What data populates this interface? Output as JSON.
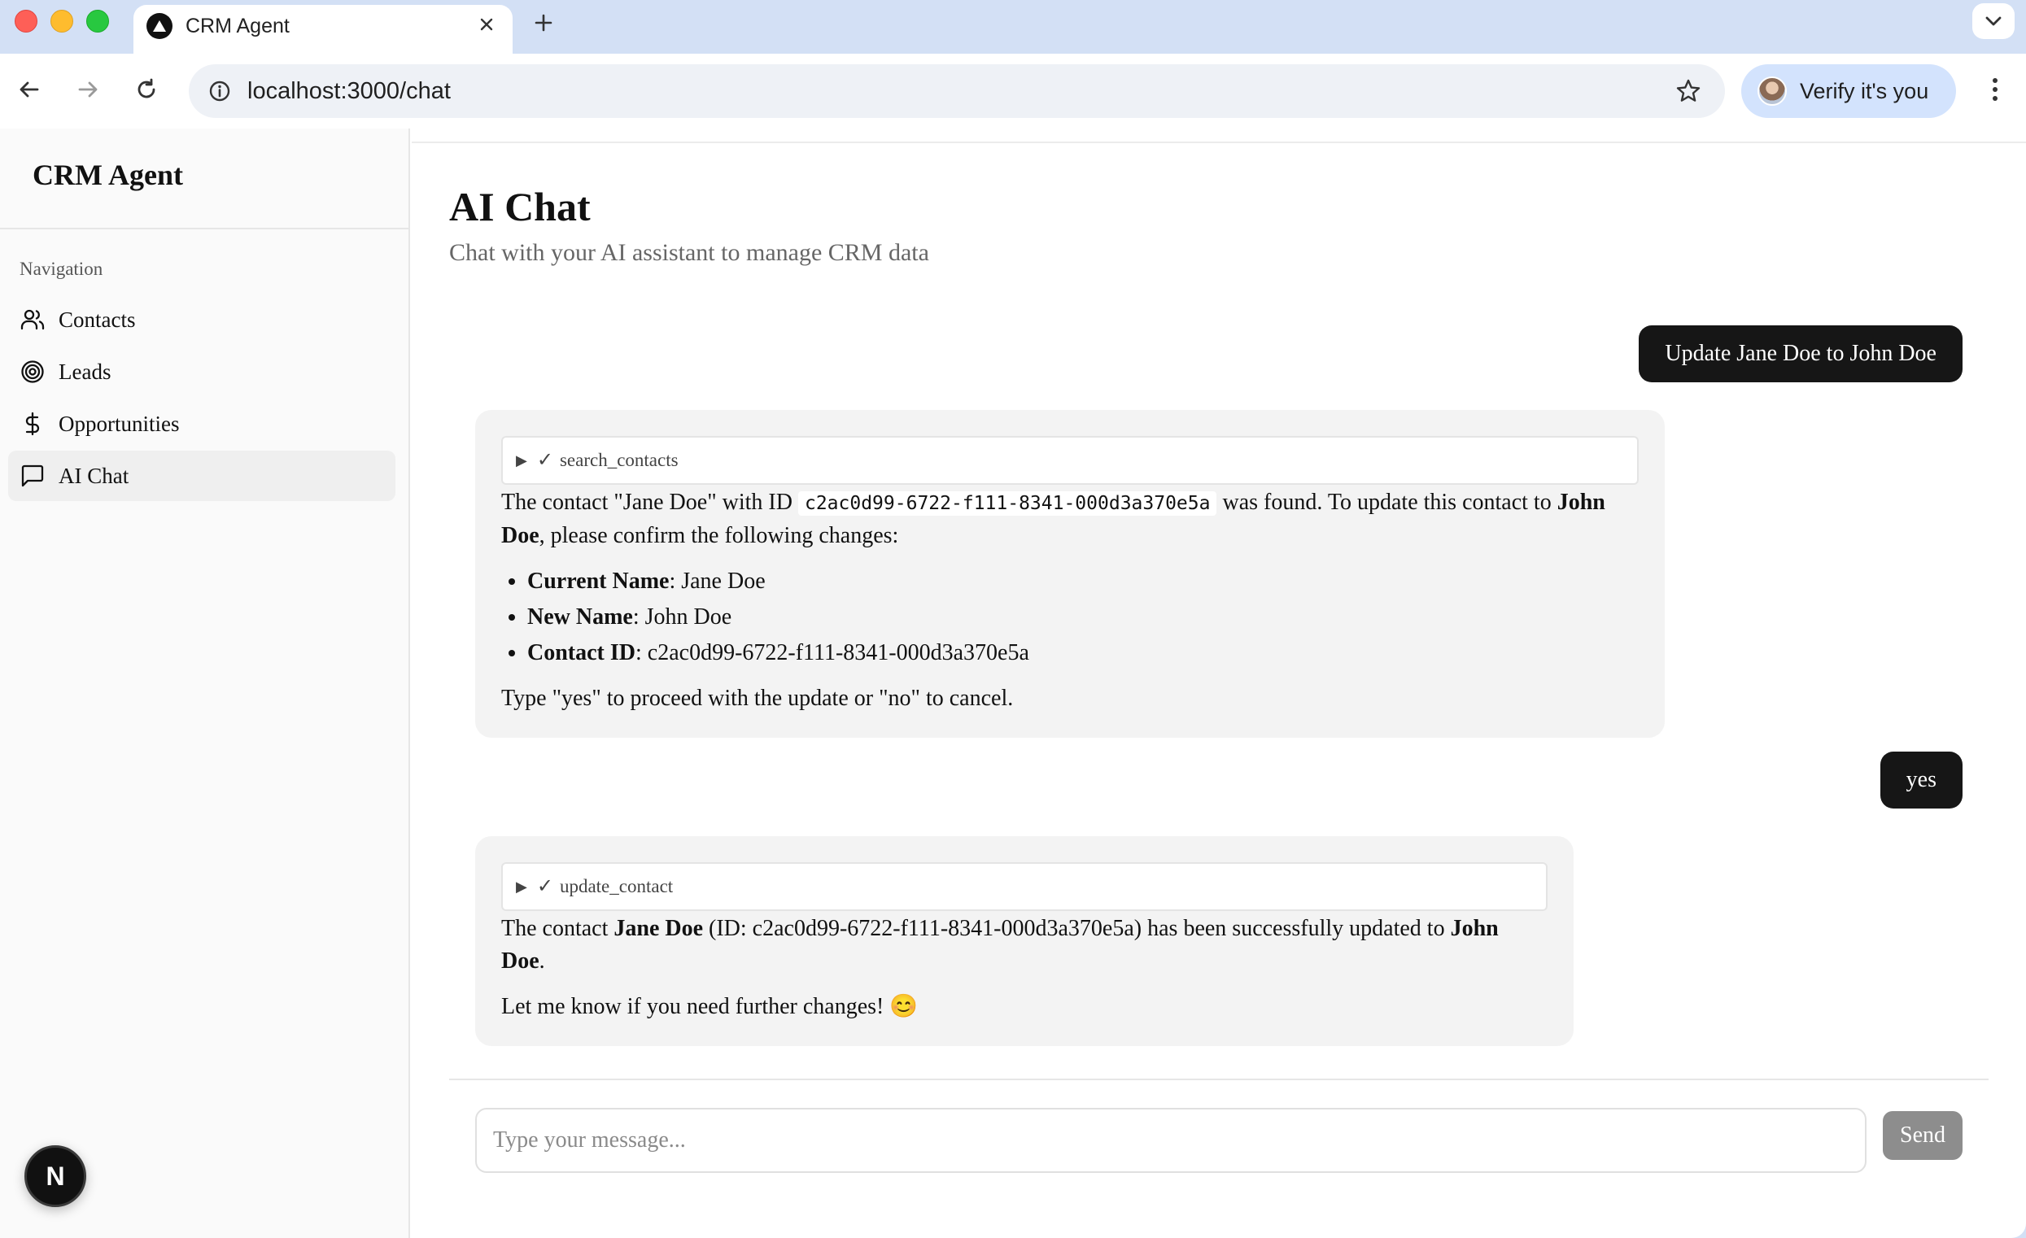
{
  "browser": {
    "tab_title": "CRM Agent",
    "url": "localhost:3000/chat",
    "profile_label": "Verify it's you"
  },
  "sidebar": {
    "brand": "CRM Agent",
    "section_label": "Navigation",
    "items": [
      {
        "label": "Contacts",
        "icon": "users-icon",
        "active": false
      },
      {
        "label": "Leads",
        "icon": "target-icon",
        "active": false
      },
      {
        "label": "Opportunities",
        "icon": "dollar-icon",
        "active": false
      },
      {
        "label": "AI Chat",
        "icon": "message-square-icon",
        "active": true
      }
    ],
    "dev_badge": "N"
  },
  "page": {
    "title": "AI Chat",
    "subtitle": "Chat with your AI assistant to manage CRM data"
  },
  "messages": [
    {
      "role": "user",
      "text": "Update Jane Doe to John Doe"
    },
    {
      "role": "assistant",
      "tool": "search_contacts",
      "p1_a": "The contact \"Jane Doe\" with ID ",
      "p1_id": "c2ac0d99-6722-f111-8341-000d3a370e5a",
      "p1_b": " was found. To update this contact to ",
      "p1_name": "John Doe",
      "p1_c": ", please confirm the following changes:",
      "list": [
        {
          "label": "Current Name",
          "value": ": Jane Doe"
        },
        {
          "label": "New Name",
          "value": ": John Doe"
        },
        {
          "label": "Contact ID",
          "value": ": c2ac0d99-6722-f111-8341-000d3a370e5a"
        }
      ],
      "p2": "Type \"yes\" to proceed with the update or \"no\" to cancel."
    },
    {
      "role": "user",
      "text": "yes"
    },
    {
      "role": "assistant",
      "tool": "update_contact",
      "p1_a": "The contact ",
      "p1_old": "Jane Doe",
      "p1_b": " (ID: c2ac0d99-6722-f111-8341-000d3a370e5a) has been successfully updated to ",
      "p1_new": "John Doe",
      "p1_c": ".",
      "p2": "Let me know if you need further changes! 😊"
    }
  ],
  "composer": {
    "placeholder": "Type your message...",
    "send_label": "Send"
  },
  "colors": {
    "user_bubble": "#161616",
    "assistant_bubble": "#f3f3f3",
    "send_button_disabled": "#8d8d8d",
    "browser_chrome": "#d3e0f5"
  }
}
